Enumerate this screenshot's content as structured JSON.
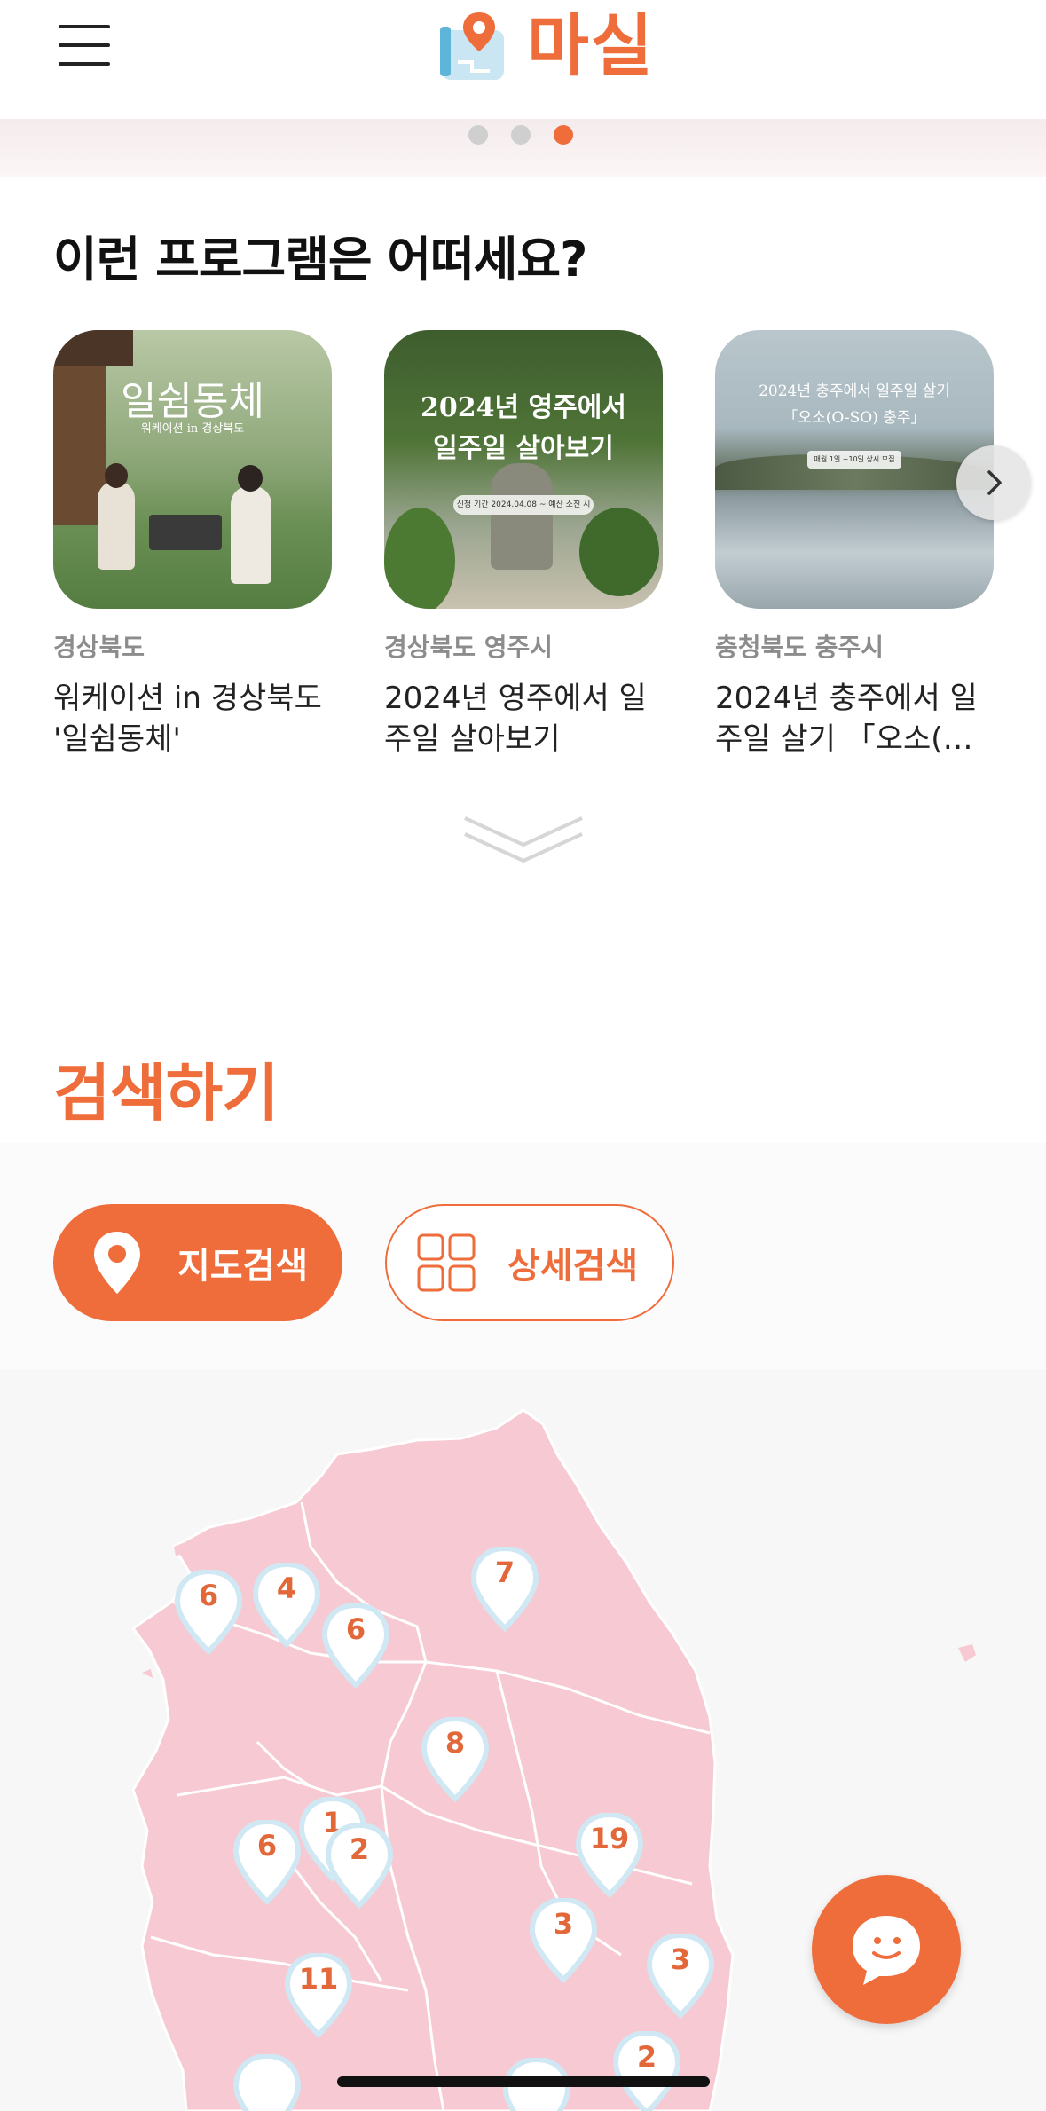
{
  "header": {
    "logo_text": "마실",
    "menu_icon": "hamburger-menu-icon",
    "logo_icon": "map-pin-logo-icon"
  },
  "carousel_dots": {
    "count": 3,
    "active_index": 2
  },
  "recommend": {
    "title": "이런 프로그램은 어떠세요?",
    "cards": [
      {
        "region": "경상북도",
        "title_lines": [
          "워케이션 in 경상북도",
          "'일쉼동체'"
        ],
        "image_text": "일쉼동체",
        "image_subtext": "워케이션 in 경상북도"
      },
      {
        "region": "경상북도 영주시",
        "title_lines": [
          "2024년 영주에서 일",
          "주일 살아보기"
        ],
        "image_text_line1": "2024년 영주에서",
        "image_text_line2": "일주일 살아보기",
        "image_subtext": "신청 기간 2024.04.08 ~ 예산 소진 시"
      },
      {
        "region": "충청북도 충주시",
        "title_lines": [
          "2024년 충주에서 일",
          "주일 살기 「오소(O-..."
        ],
        "image_text_line1": "2024년 충주에서 일주일 살기",
        "image_text_line2": "「오소(O-SO) 충주」",
        "image_subtext": "매월 1일 ~10일 상시 모집"
      }
    ],
    "next_icon": "chevron-right-icon",
    "more_icon": "double-chevron-down-icon"
  },
  "search": {
    "title": "검색하기",
    "map_search_label": "지도검색",
    "detail_search_label": "상세검색",
    "map_search_icon": "location-pin-icon",
    "detail_search_icon": "grid-icon"
  },
  "map": {
    "pins": [
      {
        "id": "a",
        "count": "6"
      },
      {
        "id": "b",
        "count": "4"
      },
      {
        "id": "c",
        "count": "6"
      },
      {
        "id": "d",
        "count": "7"
      },
      {
        "id": "e",
        "count": "8"
      },
      {
        "id": "f",
        "count": "1"
      },
      {
        "id": "g",
        "count": "2"
      },
      {
        "id": "h",
        "count": "6"
      },
      {
        "id": "i",
        "count": "19"
      },
      {
        "id": "j",
        "count": "3"
      },
      {
        "id": "k",
        "count": "3"
      },
      {
        "id": "l",
        "count": "11"
      },
      {
        "id": "m",
        "count": "2"
      }
    ]
  },
  "chat": {
    "icon": "chat-bubble-smile-icon"
  },
  "colors": {
    "accent": "#ee6d3b",
    "map_land": "#f7c9d2",
    "map_border": "#ffffff"
  }
}
